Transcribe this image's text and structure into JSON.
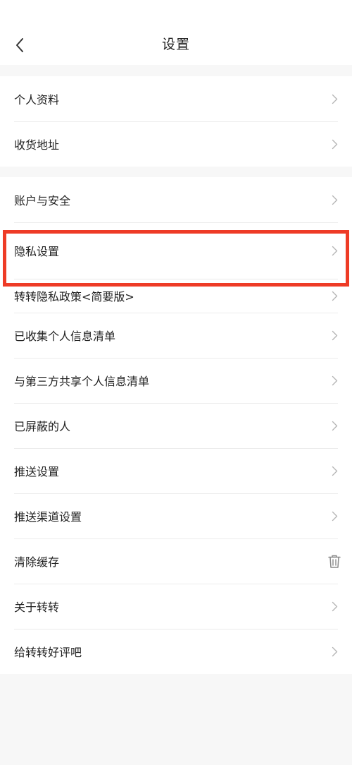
{
  "header": {
    "title": "设置"
  },
  "groups": [
    {
      "items": [
        {
          "label": "个人资料",
          "action": "chevron-right-icon"
        },
        {
          "label": "收货地址",
          "action": "chevron-right-icon"
        }
      ]
    },
    {
      "items": [
        {
          "label": "账户与安全",
          "action": "chevron-right-icon"
        },
        {
          "label": "隐私设置",
          "action": "chevron-right-icon"
        },
        {
          "label": "转转隐私政策<简要版>",
          "action": "chevron-right-icon"
        },
        {
          "label": "已收集个人信息清单",
          "action": "chevron-right-icon"
        },
        {
          "label": "与第三方共享个人信息清单",
          "action": "chevron-right-icon"
        },
        {
          "label": "已屏蔽的人",
          "action": "chevron-right-icon"
        },
        {
          "label": "推送设置",
          "action": "chevron-right-icon"
        },
        {
          "label": "推送渠道设置",
          "action": "chevron-right-icon"
        },
        {
          "label": "清除缓存",
          "action": "trash-icon"
        },
        {
          "label": "关于转转",
          "action": "chevron-right-icon"
        },
        {
          "label": "给转转好评吧",
          "action": "chevron-right-icon"
        }
      ]
    }
  ],
  "annotation": {
    "highlighted_item": "隐私设置",
    "color": "#ee3b26"
  }
}
